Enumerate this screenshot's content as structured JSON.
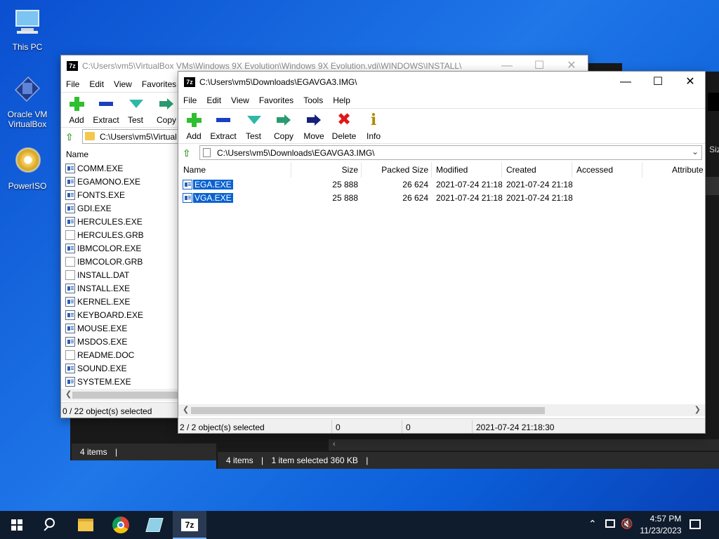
{
  "desktop": {
    "icons": [
      {
        "label": "This PC"
      },
      {
        "label": "Oracle VM VirtualBox"
      },
      {
        "label": "PowerISO"
      }
    ]
  },
  "explorer_back": {
    "status1": "4 items",
    "status2_items": "4 items",
    "status2_selected": "1 item selected  360 KB",
    "size_col": "Siz"
  },
  "win_back": {
    "title": "C:\\Users\\vm5\\VirtualBox VMs\\Windows 9X Evolution\\Windows 9X Evolution.vdi\\WINDOWS\\INSTALL\\",
    "menu": [
      "File",
      "Edit",
      "View",
      "Favorites"
    ],
    "toolbar": [
      "Add",
      "Extract",
      "Test",
      "Copy"
    ],
    "address": "C:\\Users\\vm5\\Virtual",
    "column_name": "Name",
    "files": [
      {
        "name": "COMM.EXE",
        "type": "exe"
      },
      {
        "name": "EGAMONO.EXE",
        "type": "exe"
      },
      {
        "name": "FONTS.EXE",
        "type": "exe"
      },
      {
        "name": "GDI.EXE",
        "type": "exe"
      },
      {
        "name": "HERCULES.EXE",
        "type": "exe"
      },
      {
        "name": "HERCULES.GRB",
        "type": "doc"
      },
      {
        "name": "IBMCOLOR.EXE",
        "type": "exe"
      },
      {
        "name": "IBMCOLOR.GRB",
        "type": "doc"
      },
      {
        "name": "INSTALL.DAT",
        "type": "doc"
      },
      {
        "name": "INSTALL.EXE",
        "type": "exe"
      },
      {
        "name": "KERNEL.EXE",
        "type": "exe"
      },
      {
        "name": "KEYBOARD.EXE",
        "type": "exe"
      },
      {
        "name": "MOUSE.EXE",
        "type": "exe"
      },
      {
        "name": "MSDOS.EXE",
        "type": "exe"
      },
      {
        "name": "README.DOC",
        "type": "doc"
      },
      {
        "name": "SOUND.EXE",
        "type": "exe"
      },
      {
        "name": "SYSTEM.EXE",
        "type": "exe"
      }
    ],
    "status": "0 / 22 object(s) selected"
  },
  "win_front": {
    "title": "C:\\Users\\vm5\\Downloads\\EGAVGA3.IMG\\",
    "menu": [
      "File",
      "Edit",
      "View",
      "Favorites",
      "Tools",
      "Help"
    ],
    "toolbar": [
      "Add",
      "Extract",
      "Test",
      "Copy",
      "Move",
      "Delete",
      "Info"
    ],
    "address": "C:\\Users\\vm5\\Downloads\\EGAVGA3.IMG\\",
    "columns": [
      "Name",
      "Size",
      "Packed Size",
      "Modified",
      "Created",
      "Accessed",
      "Attribute"
    ],
    "files": [
      {
        "name": "EGA.EXE",
        "size": "25 888",
        "packed": "26 624",
        "modified": "2021-07-24 21:18",
        "created": "2021-07-24 21:18"
      },
      {
        "name": "VGA.EXE",
        "size": "25 888",
        "packed": "26 624",
        "modified": "2021-07-24 21:18",
        "created": "2021-07-24 21:18"
      }
    ],
    "status": {
      "selected": "2 / 2 object(s) selected",
      "size": "0",
      "packed": "0",
      "datetime": "2021-07-24 21:18:30"
    },
    "colors": {
      "selection": "#0a62cf"
    }
  },
  "taskbar": {
    "time": "4:57 PM",
    "date": "11/23/2023",
    "apps": [
      "start-icon",
      "search-icon",
      "file-explorer-icon",
      "chrome-icon",
      "notepad-icon",
      "7zip-icon"
    ],
    "seven_zip_label": "7z"
  }
}
